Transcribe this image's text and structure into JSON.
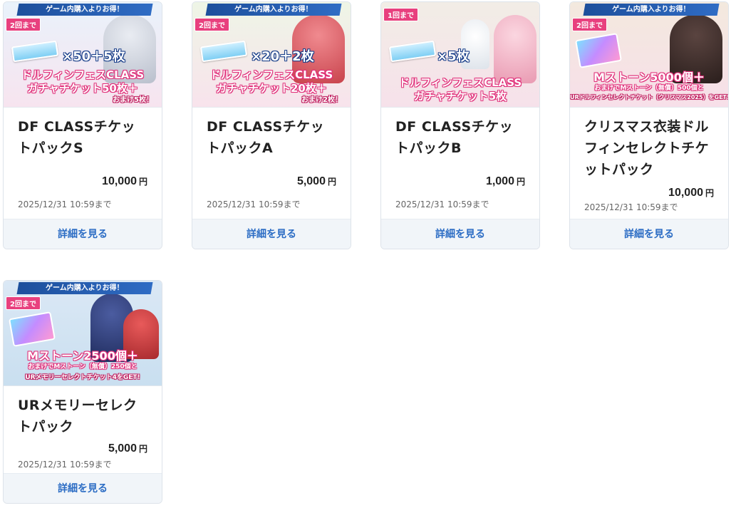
{
  "products": [
    {
      "banner": {
        "ribbon": "ゲーム内購入よりお得！",
        "badge": "2回まで",
        "count": "×50＋5枚",
        "count_note": "おまけ",
        "line1": "ドルフィンフェスCLASS",
        "line2": "ガチャチケット50枚＋",
        "line3": "おまけ5枚！",
        "bg_top": "#e9f2fb",
        "bg_bottom": "#f7e4ef",
        "char_color": "#cfd3dc"
      },
      "title": "DF CLASSチケットパックS",
      "price": "10,000",
      "currency": "円",
      "deadline": "2025/12/31 10:59まで",
      "detail_label": "詳細を見る"
    },
    {
      "banner": {
        "ribbon": "ゲーム内購入よりお得！",
        "badge": "2回まで",
        "count": "×20＋2枚",
        "count_note": "おまけ",
        "line1": "ドルフィンフェスCLASS",
        "line2": "ガチャチケット20枚＋",
        "line3": "おまけ2枚！",
        "bg_top": "#eef5e6",
        "bg_bottom": "#f8e3ec",
        "char_color": "#e25a63"
      },
      "title": "DF CLASSチケットパックA",
      "price": "5,000",
      "currency": "円",
      "deadline": "2025/12/31 10:59まで",
      "detail_label": "詳細を見る"
    },
    {
      "banner": {
        "ribbon": "",
        "badge": "1回まで",
        "count": "×5枚",
        "count_note": "",
        "line1": "ドルフィンフェスCLASS",
        "line2": "ガチャチケット5枚",
        "line3": "",
        "bg_top": "#f2ede6",
        "bg_bottom": "#f6e1ea",
        "char_color": "#f3b8c8"
      },
      "title": "DF CLASSチケットパックB",
      "price": "1,000",
      "currency": "円",
      "deadline": "2025/12/31 10:59まで",
      "detail_label": "詳細を見る"
    },
    {
      "banner": {
        "ribbon": "ゲーム内購入よりお得！",
        "badge": "2回まで",
        "count": "",
        "count_note": "",
        "line1": "Mストーン5000個＋",
        "line2": "おまけでMストーン（無償）500個と",
        "line3": "URドルフィンセレクトチケット（クリスマス2025）をGET!",
        "bg_top": "#f3e9de",
        "bg_bottom": "#f7dfe9",
        "char_color": "#3a2a28"
      },
      "title": "クリスマス衣装ドルフィンセレクトチケットパック",
      "price": "10,000",
      "currency": "円",
      "deadline": "2025/12/31 10:59まで",
      "detail_label": "詳細を見る"
    },
    {
      "banner": {
        "ribbon": "ゲーム内購入よりお得！",
        "badge": "2回まで",
        "count": "",
        "count_note": "",
        "line1": "Mストーン2500個＋",
        "line2": "おまけでMストーン（無償）250個と",
        "line3": "URメモリーセレクトチケット4をGET!",
        "bg_top": "#dbe8f5",
        "bg_bottom": "#c9dff0",
        "char_color": "#2f3f7a"
      },
      "title": "URメモリーセレクトパック",
      "price": "5,000",
      "currency": "円",
      "deadline": "2025/12/31 10:59まで",
      "detail_label": "詳細を見る"
    }
  ]
}
